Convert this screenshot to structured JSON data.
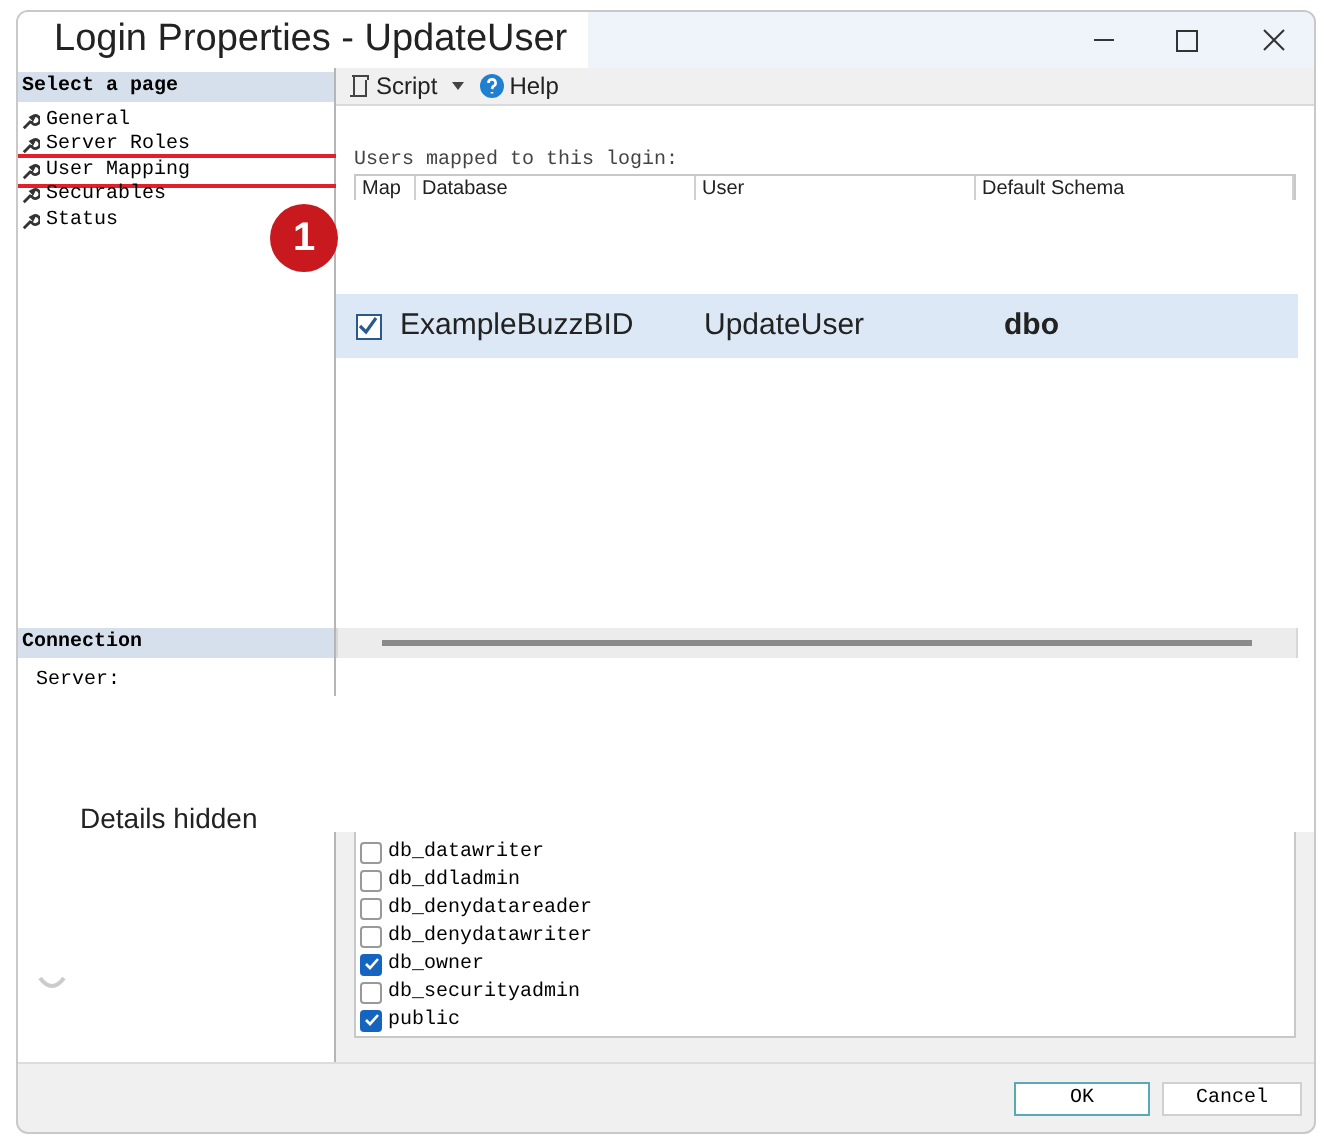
{
  "window": {
    "title": "Login Properties - UpdateUser"
  },
  "sidebar": {
    "header": "Select a page",
    "items": [
      {
        "label": "General",
        "selected": false
      },
      {
        "label": "Server Roles",
        "selected": false
      },
      {
        "label": "User Mapping",
        "selected": true
      },
      {
        "label": "Securables",
        "selected": false
      },
      {
        "label": "Status",
        "selected": false
      }
    ],
    "connection": {
      "header": "Connection",
      "label": "Server:"
    }
  },
  "annotation": {
    "badge": "1"
  },
  "toolbar": {
    "buttons": [
      "Script",
      "Help"
    ]
  },
  "mapping": {
    "label": "Users mapped to this login:",
    "columns": [
      "Map",
      "Database",
      "User",
      "Default Schema"
    ],
    "rows": [
      {
        "mapped": true,
        "selected": true,
        "database": "ExampleBuzzBID",
        "user": "UpdateUser",
        "schema": "dbo"
      }
    ]
  },
  "overlay": {
    "text": "Details hidden"
  },
  "roles": [
    {
      "name": "db_datawriter",
      "checked": false
    },
    {
      "name": "db_ddladmin",
      "checked": false
    },
    {
      "name": "db_denydatareader",
      "checked": false
    },
    {
      "name": "db_denydatawriter",
      "checked": false
    },
    {
      "name": "db_owner",
      "checked": true
    },
    {
      "name": "db_securityadmin",
      "checked": false
    },
    {
      "name": "public",
      "checked": true
    }
  ],
  "buttons": [
    "OK",
    "Cancel"
  ]
}
